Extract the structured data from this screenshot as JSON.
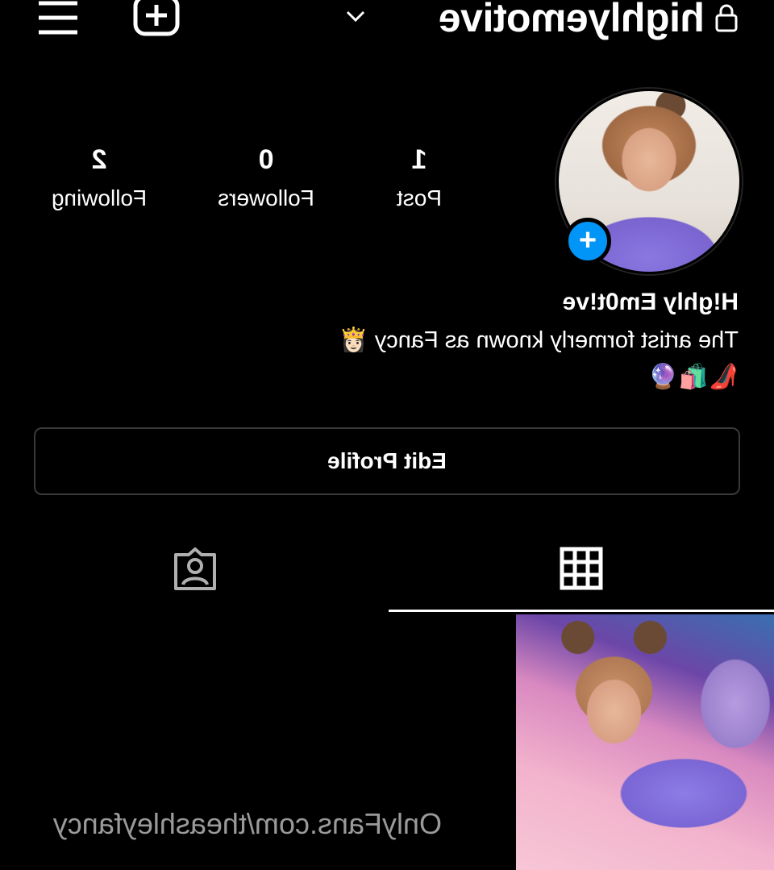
{
  "header": {
    "username": "highlyemotive",
    "icons": [
      "lock-icon",
      "chevron-down-icon",
      "new-post-icon",
      "menu-icon"
    ]
  },
  "profile": {
    "stats": {
      "posts_count": "1",
      "posts_label": "Post",
      "followers_count": "0",
      "followers_label": "Followers",
      "following_count": "2",
      "following_label": "Following"
    },
    "display_name": "H!ghly Em0t!ve",
    "bio_line": "The artist formerly known as Fancy 👸🏻",
    "bio_emoji": "👠🛍️🔮",
    "edit_profile_label": "Edit Profile"
  },
  "tabs": [
    {
      "name": "posts-grid",
      "icon": "grid-icon",
      "selected": true
    },
    {
      "name": "tagged",
      "icon": "tagged-person-icon",
      "selected": false
    }
  ],
  "watermark": "OnlyFans.com/theashleyfancy",
  "colors": {
    "background": "#000000",
    "accent": "#0095f6",
    "text": "#ffffff",
    "border": "#3a3a3a"
  }
}
